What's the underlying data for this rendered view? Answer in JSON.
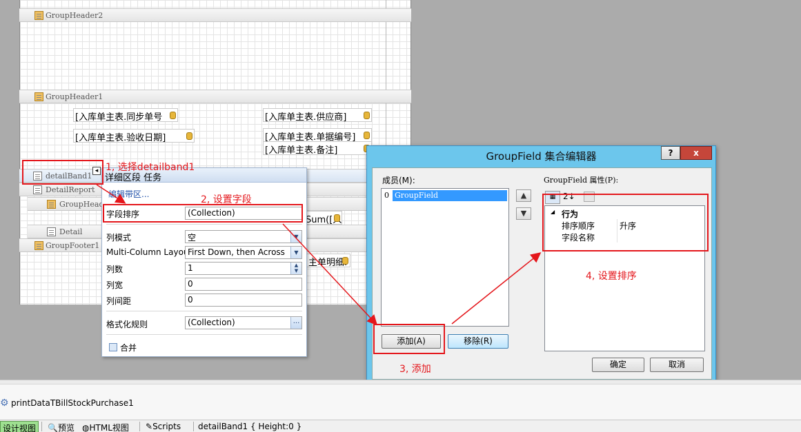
{
  "bands": {
    "group_header2": "GroupHeader2",
    "group_header1": "GroupHeader1",
    "detail_band1": "detailBand1",
    "detail_report": "DetailReport",
    "group_header_sub": "GroupHeade",
    "detail": "Detail",
    "group_footer1": "GroupFooter1"
  },
  "fields": {
    "sync_no": "[入库单主表.同步单号",
    "supplier": "[入库单主表.供应商]",
    "check_date": "[入库单主表.验收日期]",
    "bill_no": "[入库单主表.单据编号]",
    "remark": "[入库单主表.备注]",
    "sum_partial": "Sum([入",
    "detail_partial": "主单明细."
  },
  "task_panel": {
    "title": "详细区段 任务",
    "edit_bands_link": "编辑带区...",
    "sort_fields_label": "字段排序",
    "sort_fields_value": "(Collection)",
    "column_mode_label": "列模式",
    "column_mode_value": "空",
    "multi_col_label": "Multi-Column Layout",
    "multi_col_value": "First Down, then Across",
    "column_count_label": "列数",
    "column_count_value": "1",
    "column_width_label": "列宽",
    "column_width_value": "0",
    "column_spacing_label": "列间距",
    "column_spacing_value": "0",
    "format_rules_label": "格式化规则",
    "format_rules_value": "(Collection)",
    "merge_label": "合并",
    "ellipsis": "..."
  },
  "dialog": {
    "title": "GroupField 集合编辑器",
    "help": "?",
    "close": "x",
    "members_label": "成员(M):",
    "member_index": "0",
    "member_name": "GroupField",
    "properties_label": "GroupField 属性(P):",
    "category_behavior": "行为",
    "prop_sort_order_key": "排序顺序",
    "prop_sort_order_value": "升序",
    "prop_field_name_key": "字段名称",
    "prop_field_name_value": "",
    "add_button": "添加(A)",
    "remove_button": "移除(R)",
    "ok_button": "确定",
    "cancel_button": "取消",
    "sort_az": "2↓"
  },
  "annotations": {
    "step1": "1, 选择detailband1",
    "step2": "2, 设置字段",
    "step3": "3, 添加",
    "step4": "4, 设置排序"
  },
  "tray": {
    "component": "printDataTBillStockPurchase1"
  },
  "statusbar": {
    "design_view": "设计视图",
    "preview": "预览",
    "html_view": "HTML视图",
    "scripts": "Scripts",
    "selection": "detailBand1 { Height:0 }"
  },
  "colors": {
    "annotation_red": "#e4161b",
    "dialog_chrome": "#6cc6ec",
    "selection_blue": "#3399ff"
  }
}
